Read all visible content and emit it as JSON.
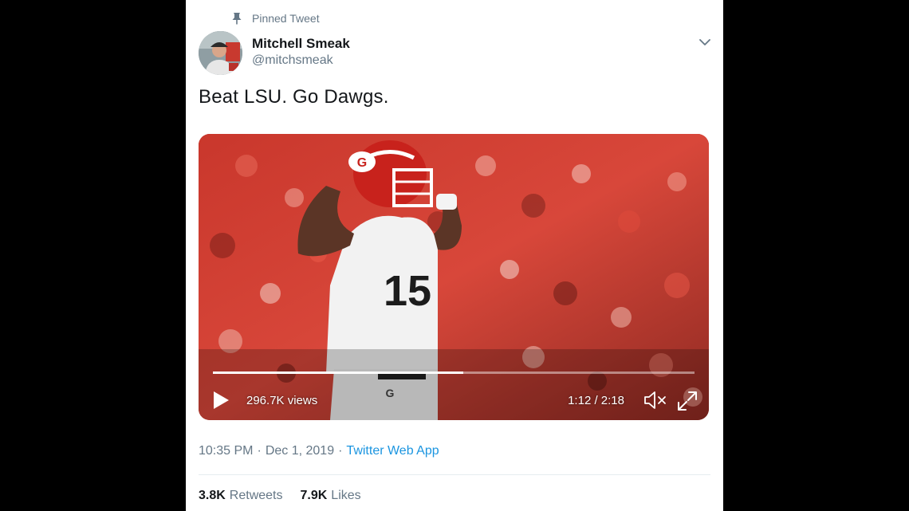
{
  "pinned": {
    "label": "Pinned Tweet",
    "icon": "pin-icon"
  },
  "user": {
    "name": "Mitchell Smeak",
    "handle": "@mitchsmeak"
  },
  "tweet": {
    "text": "Beat LSU. Go Dawgs."
  },
  "video": {
    "views": "296.7K views",
    "time": "1:12 / 2:18",
    "progress": 0.52,
    "jersey_number": "15",
    "icons": {
      "play": "play-icon",
      "mute": "muted-speaker-icon",
      "fullscreen": "fullscreen-icon"
    }
  },
  "meta": {
    "time": "10:35 PM",
    "separator": "·",
    "date": "Dec 1, 2019",
    "source": "Twitter Web App"
  },
  "stats": {
    "retweets_count": "3.8K",
    "retweets_label": "Retweets",
    "likes_count": "7.9K",
    "likes_label": "Likes"
  },
  "colors": {
    "link": "#1b95e0",
    "secondary_text": "#657786",
    "primary_text": "#14171a"
  }
}
